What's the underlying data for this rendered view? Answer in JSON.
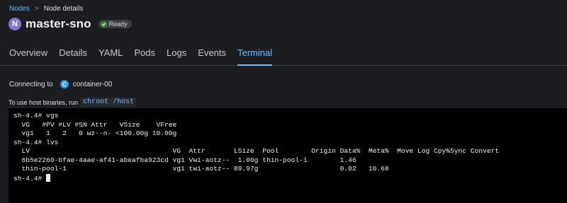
{
  "breadcrumb": {
    "link": "Nodes",
    "separator": ">",
    "current": "Node details"
  },
  "header": {
    "badge_letter": "N",
    "node_name": "master-sno",
    "status": "Ready"
  },
  "tabs": [
    {
      "label": "Overview"
    },
    {
      "label": "Details"
    },
    {
      "label": "YAML"
    },
    {
      "label": "Pods"
    },
    {
      "label": "Logs"
    },
    {
      "label": "Events"
    },
    {
      "label": "Terminal",
      "active": true
    }
  ],
  "connecting": {
    "label": "Connecting to",
    "badge_letter": "C",
    "container": "container-00"
  },
  "hint": {
    "text": "To use host binaries, run",
    "command": "chroot /host"
  },
  "terminal": {
    "lines": [
      "sh-4.4# vgs",
      "  VG   #PV #LV #SN Attr   VSize    VFree",
      "  vg1   1   2   0 wz--n- <100.00g 10.00g",
      "sh-4.4# lvs",
      "  LV                                   VG  Attr       LSize  Pool        Origin Data%  Meta%  Move Log Cpy%Sync Convert",
      "  6b5e2260-bfae-4aae-af41-abeafba923cd vg1 Vwi-aotz--  1.00g thin-pool-1        1.46",
      "  thin-pool-1                          vg1 twi-aotz-- 89.97g                    0.02   10.68"
    ],
    "prompt": "sh-4.4# "
  },
  "colors": {
    "accent": "#73bcf7",
    "node_badge": "#8476d1",
    "ready_green": "#3e8635",
    "container_badge": "#2b9af3"
  }
}
